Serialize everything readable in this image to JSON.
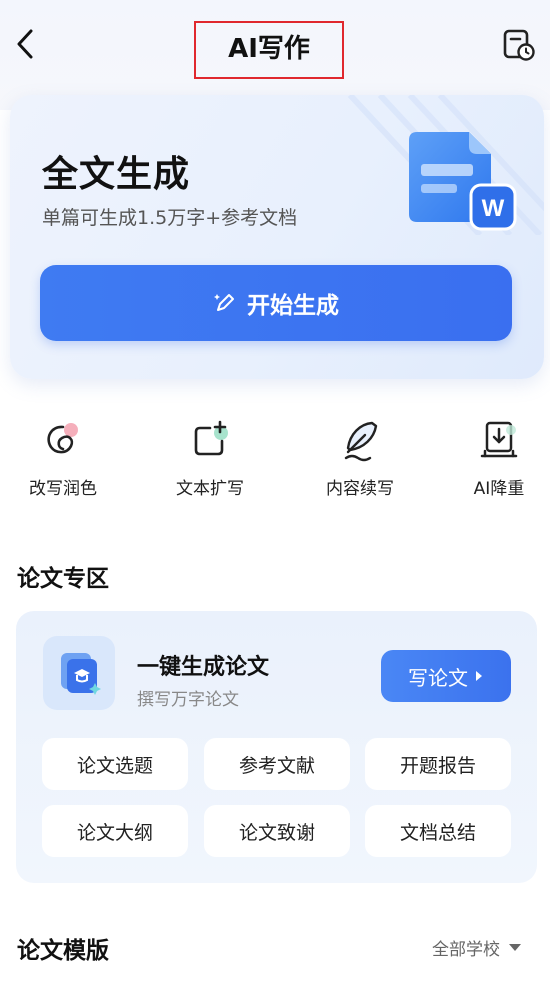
{
  "header": {
    "title": "AI写作",
    "back_icon": "chevron-left-icon",
    "history_icon": "document-history-icon"
  },
  "hero": {
    "title": "全文生成",
    "subtitle": "单篇可生成1.5万字+参考文档",
    "start_button": "开始生成",
    "doc_badge": "W"
  },
  "tools": [
    {
      "label": "改写润色",
      "icon": "rewrite-icon"
    },
    {
      "label": "文本扩写",
      "icon": "expand-icon"
    },
    {
      "label": "内容续写",
      "icon": "quill-icon"
    },
    {
      "label": "AI降重",
      "icon": "download-doc-icon"
    }
  ],
  "paper_section": {
    "title": "论文专区",
    "card_title": "一键生成论文",
    "card_subtitle": "撰写万字论文",
    "write_button": "写论文",
    "chips": [
      "论文选题",
      "参考文献",
      "开题报告",
      "论文大纲",
      "论文致谢",
      "文档总结"
    ]
  },
  "template_section": {
    "title": "论文模版",
    "filter_label": "全部学校"
  },
  "colors": {
    "accent": "#3b72ee",
    "highlight_box": "#e0282e"
  }
}
